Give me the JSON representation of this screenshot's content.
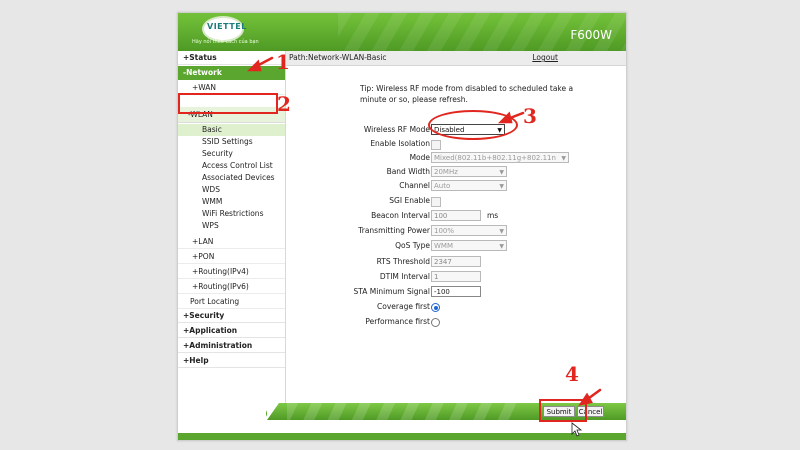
{
  "header": {
    "brand": "VIETTEL",
    "slogan": "Hãy nói theo cách của bạn",
    "model": "F600W"
  },
  "path": {
    "text": "Path:Network-WLAN-Basic",
    "logout": "Logout"
  },
  "sidebar": {
    "status": "+Status",
    "network": "-Network",
    "wan": "+WAN",
    "wlan": "-WLAN",
    "wlan_items": [
      "Basic",
      "SSID Settings",
      "Security",
      "Access Control List",
      "Associated Devices",
      "WDS",
      "WMM",
      "WiFi Restrictions",
      "WPS"
    ],
    "lan": "+LAN",
    "pon": "+PON",
    "routing4": "+Routing(IPv4)",
    "routing6": "+Routing(IPv6)",
    "port": "Port Locating",
    "security": "+Security",
    "application": "+Application",
    "administration": "+Administration",
    "help": "+Help",
    "help_icon_glyph": "?"
  },
  "tip": "Tip: Wireless RF mode from disabled to scheduled take a minute or so, please refresh.",
  "form": {
    "rf_mode": {
      "label": "Wireless RF Mode",
      "value": "Disabled"
    },
    "isolation": {
      "label": "Enable Isolation"
    },
    "mode": {
      "label": "Mode",
      "value": "Mixed(802.11b+802.11g+802.11n"
    },
    "bandwidth": {
      "label": "Band Width",
      "value": "20MHz"
    },
    "channel": {
      "label": "Channel",
      "value": "Auto"
    },
    "sgi": {
      "label": "SGI Enable"
    },
    "beacon": {
      "label": "Beacon Interval",
      "value": "100",
      "unit": "ms"
    },
    "power": {
      "label": "Transmitting Power",
      "value": "100%"
    },
    "qos": {
      "label": "QoS Type",
      "value": "WMM"
    },
    "rts": {
      "label": "RTS Threshold",
      "value": "2347"
    },
    "dtim": {
      "label": "DTIM Interval",
      "value": "1"
    },
    "sta": {
      "label": "STA Minimum Signal",
      "value": "-100"
    },
    "coverage": {
      "label": "Coverage first",
      "selected": true
    },
    "performance": {
      "label": "Performance first",
      "selected": false
    }
  },
  "buttons": {
    "submit": "Submit",
    "cancel": "Cancel"
  },
  "annotations": [
    "1",
    "2",
    "3",
    "4"
  ],
  "colors": {
    "accent_green": "#5aa62e",
    "annotation_red": "#e0261f"
  }
}
